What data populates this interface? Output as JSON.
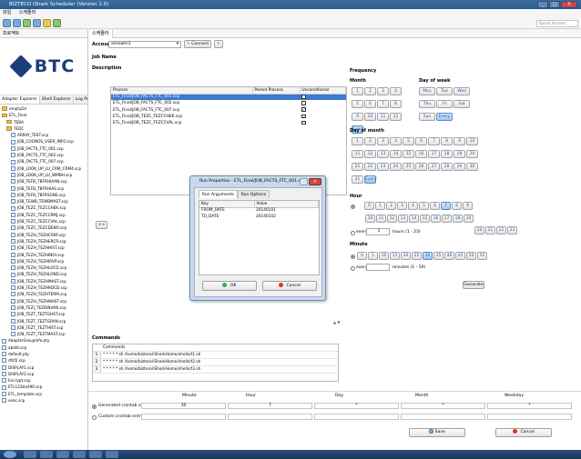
{
  "window": {
    "title": "BIZTECO iShark Scheduler (Version 1.0)",
    "controls": [
      "_",
      "□",
      "X"
    ]
  },
  "menu": [
    "파일",
    "스케줄러"
  ],
  "quick_access": "Quick Access",
  "left_panel": {
    "title": "프로젝트",
    "logo_text": "BTC",
    "tabs": [
      "Adapter Explorer",
      "Shell Explorer",
      "Log Process Ex"
    ],
    "tree": [
      {
        "label": "emptyDir",
        "type": "folder",
        "indent": 0
      },
      {
        "label": "ETL_Final",
        "type": "folder",
        "indent": 0
      },
      {
        "label": "TEBA",
        "type": "folder",
        "indent": 1
      },
      {
        "label": "TEDC",
        "type": "folder",
        "indent": 1
      },
      {
        "label": "ARRAY_TEST.scp",
        "type": "file",
        "indent": 2
      },
      {
        "label": "JOB_COGNOS_USER_INFO.scp",
        "type": "file",
        "indent": 2
      },
      {
        "label": "JOB_FACTS_FTC_001.scp",
        "type": "file",
        "indent": 2
      },
      {
        "label": "JOB_FACTS_FTC_002.scp",
        "type": "file",
        "indent": 2
      },
      {
        "label": "JOB_FACTS_FTC_007.scp",
        "type": "file",
        "indent": 2
      },
      {
        "label": "JOB_LOOK_UP_LU_CRM_CRM4.scp",
        "type": "file",
        "indent": 2
      },
      {
        "label": "JOB_LOOK_UP_LU_WMBH.scp",
        "type": "file",
        "indent": 2
      },
      {
        "label": "JOB_TEFB_TBFRHIAAN.scp",
        "type": "file",
        "indent": 2
      },
      {
        "label": "JOB_TEFB_TBFRHIAS.scp",
        "type": "file",
        "indent": 2
      },
      {
        "label": "JOB_TEFB_TBFRSGNS.scp",
        "type": "file",
        "indent": 2
      },
      {
        "label": "JOB_TEWB_TEWBMAST.scp",
        "type": "file",
        "indent": 2
      },
      {
        "label": "JOB_TEZC_TEZCCHEK.scp",
        "type": "file",
        "indent": 2
      },
      {
        "label": "JOB_TEZC_TEZCCRMJ.scp",
        "type": "file",
        "indent": 2
      },
      {
        "label": "JOB_TEZC_TEZCCVAL.scp",
        "type": "file",
        "indent": 2
      },
      {
        "label": "JOB_TEZC_TEZCDENO.scp",
        "type": "file",
        "indent": 2
      },
      {
        "label": "JOB_TEZH_TEZHCRBF.scp",
        "type": "file",
        "indent": 2
      },
      {
        "label": "JOB_TEZH_TEZHERCR.scp",
        "type": "file",
        "indent": 2
      },
      {
        "label": "JOB_TEZH_TEZHHIST.scp",
        "type": "file",
        "indent": 2
      },
      {
        "label": "JOB_TEZH_TEZHINOI.scp",
        "type": "file",
        "indent": 2
      },
      {
        "label": "JOB_TEZH_TEZHIRVP.scp",
        "type": "file",
        "indent": 2
      },
      {
        "label": "JOB_TEZH_TEZHLOCD.scp",
        "type": "file",
        "indent": 2
      },
      {
        "label": "JOB_TEZH_TEZHLOND.scp",
        "type": "file",
        "indent": 2
      },
      {
        "label": "JOB_TEZH_TEZHMAST.scp",
        "type": "file",
        "indent": 2
      },
      {
        "label": "JOB_TEZH_TEZHRDCD.scp",
        "type": "file",
        "indent": 2
      },
      {
        "label": "JOB_TEZH_TEZHTERM.scp",
        "type": "file",
        "indent": 2
      },
      {
        "label": "JOB_TEZH_TEZHWAST.scp",
        "type": "file",
        "indent": 2
      },
      {
        "label": "JOB_TEZI_TEZIDNVAN.scp",
        "type": "file",
        "indent": 2
      },
      {
        "label": "JOB_TEZT_TEZTGHST.scp",
        "type": "file",
        "indent": 2
      },
      {
        "label": "JOB_TEZT_TEZTGRAN.scp",
        "type": "file",
        "indent": 2
      },
      {
        "label": "JOB_TEZT_TEZTHIST.scp",
        "type": "file",
        "indent": 2
      },
      {
        "label": "JOB_TEZT_TEZTMAST.scp",
        "type": "file",
        "indent": 2
      },
      {
        "label": "AdapterGroupInfo.pty",
        "type": "file",
        "indent": 0
      },
      {
        "label": "abddl.scp",
        "type": "file",
        "indent": 0
      },
      {
        "label": "default.pty",
        "type": "file",
        "indent": 0
      },
      {
        "label": "dfsf2.scp",
        "type": "file",
        "indent": 0
      },
      {
        "label": "DISPLAY1.scp",
        "type": "file",
        "indent": 0
      },
      {
        "label": "DISPLAY2.scp",
        "type": "file",
        "indent": 0
      },
      {
        "label": "Encrypt.scp",
        "type": "file",
        "indent": 0
      },
      {
        "label": "ETL123test90.scp",
        "type": "file",
        "indent": 0
      },
      {
        "label": "ETL_template.scp",
        "type": "file",
        "indent": 0
      },
      {
        "label": "exac.scp",
        "type": "file",
        "indent": 0
      }
    ]
  },
  "editor": {
    "tab": "스케줄러",
    "account_label": "Account",
    "account_value": "sesnwm1",
    "connect_label": "Connect",
    "job_name_label": "Job Name",
    "description_label": "Description",
    "move_button": ">>",
    "process_table": {
      "columns": [
        "Process",
        "Parent Process",
        "Unconditional"
      ],
      "rows": [
        {
          "process": "ETL_Final/JOB_FACTS_FTC_001.scp",
          "parent": "",
          "checked": false,
          "selected": true
        },
        {
          "process": "ETL_Final/JOB_FACTS_FTC_002.scp",
          "parent": "",
          "checked": false,
          "selected": false
        },
        {
          "process": "ETL_Final/JOB_FACTS_FTC_007.scp",
          "parent": "",
          "checked": true,
          "selected": false
        },
        {
          "process": "ETL_Final/JOB_TEZC_TEZCCHEK.scp",
          "parent": "",
          "checked": true,
          "selected": false
        },
        {
          "process": "ETL_Final/JOB_TEZC_TEZCCVAL.scp",
          "parent": "",
          "checked": false,
          "selected": false
        }
      ]
    },
    "resize_glyph": "▲ ▼"
  },
  "dialog": {
    "title": "Run Properties - ETL_Final/JOB_FACTS_FTC_001.scp",
    "tabs": [
      "Run Arguments",
      "Run Options"
    ],
    "columns": [
      "Key",
      "Value"
    ],
    "rows": [
      {
        "key": "FROM_DATE",
        "value": "20140101"
      },
      {
        "key": "TO_DATE",
        "value": "20140102"
      }
    ],
    "ok_label": "OK",
    "cancel_label": "Cancel"
  },
  "frequency": {
    "title": "Frequency",
    "month_label": "Month",
    "months": [
      "1",
      "2",
      "3",
      "4",
      "5",
      "6",
      "7",
      "8",
      "9",
      "10",
      "11",
      "12",
      "Every"
    ],
    "month_selected": "Every",
    "dow_label": "Day of week",
    "dows": [
      "Mon",
      "Tue",
      "Wed",
      "Thu",
      "Fri",
      "Sat",
      "Sun",
      "Every"
    ],
    "dow_selected": "Every",
    "dom_label": "Day of month",
    "doms": [
      "1",
      "2",
      "3",
      "4",
      "5",
      "6",
      "7",
      "8",
      "9",
      "10",
      "11",
      "12",
      "13",
      "14",
      "15",
      "16",
      "17",
      "18",
      "19",
      "20",
      "21",
      "22",
      "23",
      "24",
      "25",
      "26",
      "27",
      "28",
      "29",
      "30",
      "31",
      "Every"
    ],
    "dom_selected": "Every",
    "hour_label": "Hour",
    "hours": [
      "0",
      "1",
      "2",
      "3",
      "4",
      "5",
      "6",
      "7",
      "8",
      "9",
      "10",
      "11",
      "12",
      "13",
      "14",
      "15",
      "16",
      "17",
      "18",
      "19",
      "20",
      "21",
      "22",
      "23"
    ],
    "hour_selected": "7",
    "hour_every": "every",
    "hour_every_value": "1",
    "hour_range": "hours (1 - 23)",
    "minute_label": "Minute",
    "minutes": [
      "0",
      "5",
      "10",
      "15",
      "20",
      "25",
      "30",
      "35",
      "40",
      "45",
      "50",
      "55"
    ],
    "minute_selected": "30",
    "minute_every": "every",
    "minute_range": "minutes (1 - 59)",
    "generate_label": "Generate"
  },
  "commands": {
    "title": "Commands",
    "header": "Commands",
    "rows": [
      {
        "n": "1",
        "cmd": "* * * * * sh /home/biztero/iSharkHome/shells/t1.sh"
      },
      {
        "n": "2",
        "cmd": "* * * * * sh /home/biztero/iSharkHome/shells/t2.sh"
      },
      {
        "n": "3",
        "cmd": "* * * * * sh /home/biztero/iSharkHome/shells/t3.sh"
      }
    ]
  },
  "cron": {
    "headers": [
      "Minute",
      "Hour",
      "Day",
      "Month",
      "Weekday"
    ],
    "generated_label": "Generated crontab entry",
    "generated_values": [
      "30",
      "7",
      "*",
      "*",
      "*"
    ],
    "custom_label": "Custom crontab entry",
    "save_label": "Save",
    "cancel_label": "Cancel"
  }
}
